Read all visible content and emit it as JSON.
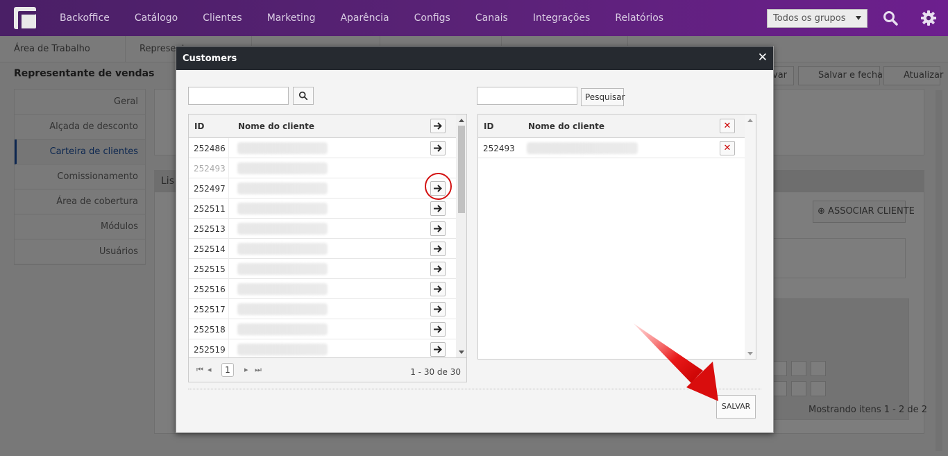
{
  "nav": {
    "items": [
      "Backoffice",
      "Catálogo",
      "Clientes",
      "Marketing",
      "Aparência",
      "Configs",
      "Canais",
      "Integrações",
      "Relatórios"
    ],
    "group_select": "Todos os grupos"
  },
  "page": {
    "tabs": [
      "Área de Trabalho",
      "Represent"
    ],
    "title": "Representante de vendas",
    "toolbar": {
      "save_partial": "var",
      "save_close": "Salvar e fechar",
      "refresh": "Atualizar"
    },
    "menu": [
      "Geral",
      "Alçada de desconto",
      "Carteira de clientes",
      "Comissionamento",
      "Área de cobertura",
      "Módulos",
      "Usuários"
    ],
    "panel_header_partial": "Lis",
    "associate_button": "ASSOCIAR CLIENTE",
    "showing": "Mostrando itens 1 - 2 de 2"
  },
  "modal": {
    "title": "Customers",
    "left": {
      "search_value": "",
      "col_id": "ID",
      "col_name": "Nome do cliente",
      "rows": [
        {
          "id": "252486",
          "name": "Alexander Cho",
          "disabled": false
        },
        {
          "id": "252493",
          "name": "Vin Hugene de Moura Araujo",
          "disabled": true
        },
        {
          "id": "252497",
          "name": "Esmerim Asparin",
          "disabled": false
        },
        {
          "id": "252511",
          "name": "Adali Bella",
          "disabled": false
        },
        {
          "id": "252513",
          "name": "Dinaio Tato",
          "disabled": false
        },
        {
          "id": "252514",
          "name": "Renata Borlinni",
          "disabled": false
        },
        {
          "id": "252515",
          "name": "Jessie Ioridero",
          "disabled": false
        },
        {
          "id": "252516",
          "name": "Tiaele Alel",
          "disabled": false
        },
        {
          "id": "252517",
          "name": "Fernandes Emdeo",
          "disabled": false
        },
        {
          "id": "252518",
          "name": "Lindoso Tilede",
          "disabled": false
        },
        {
          "id": "252519",
          "name": "Lucas Betro Aid Santos",
          "disabled": false
        }
      ],
      "pager": {
        "page": "1",
        "info": "1 - 30 de 30"
      }
    },
    "right": {
      "search_value": "",
      "search_button": "Pesquisar",
      "col_id": "ID",
      "col_name": "Nome do cliente",
      "rows": [
        {
          "id": "252493",
          "name": "Vin Hugene de Moura Araujo"
        }
      ]
    },
    "save_button": "SALVAR"
  },
  "colors": {
    "nav_bg": "#4a1f66",
    "modal_header": "#262a30",
    "accent_blue": "#1a4fa0",
    "annotation_red": "#d31010"
  }
}
